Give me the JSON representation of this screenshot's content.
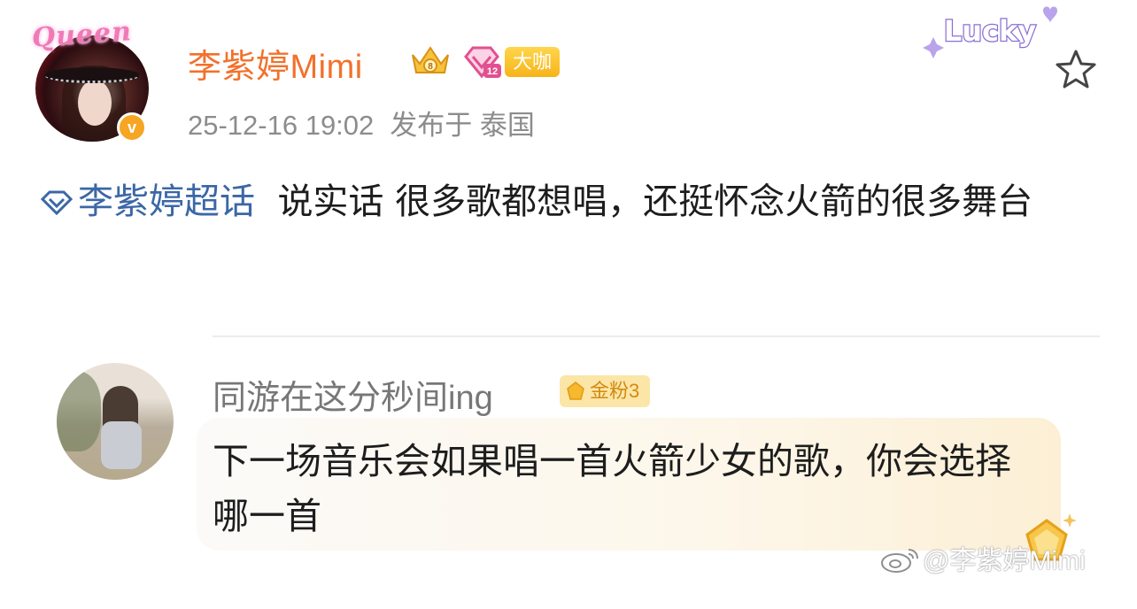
{
  "author": {
    "name": "李紫婷Mimi",
    "avatar_label": "Queen",
    "badge_label": "大咖",
    "diamond_level": "12",
    "timestamp": "25-12-16 19:02",
    "location": "发布于 泰国"
  },
  "decoration": {
    "sticker_text": "Lucky"
  },
  "post": {
    "topic": "李紫婷超话",
    "text": "说实话 很多歌都想唱，还挺怀念火箭的很多舞台"
  },
  "comment": {
    "username": "同游在这分秒间ing",
    "fan_badge": "金粉3",
    "text": "下一场音乐会如果唱一首火箭少女的歌，你会选择哪一首"
  },
  "watermark": {
    "text": "@李紫婷Mimi"
  },
  "colors": {
    "name": "#f2712b",
    "topic": "#3b67a6",
    "meta": "#8c8c8c",
    "badge_gold": "#f7b319"
  }
}
